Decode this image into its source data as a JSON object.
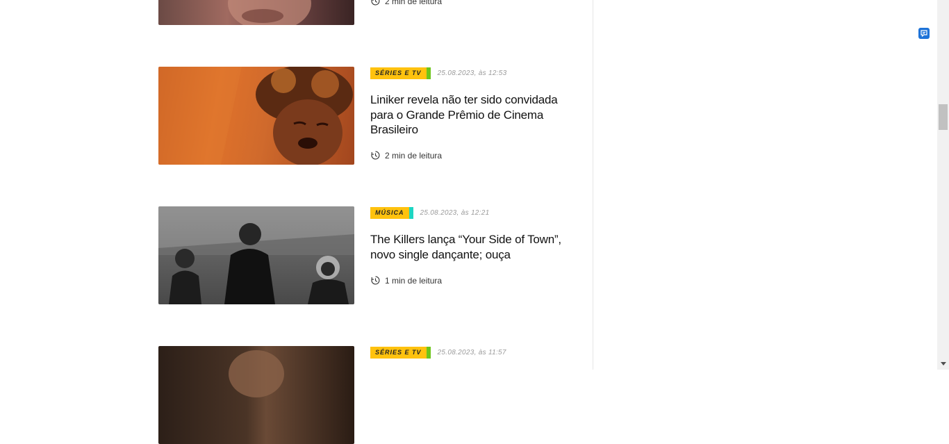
{
  "articles": [
    {
      "tag": "",
      "date": "",
      "title": "",
      "read_time": "2 min de leitura"
    },
    {
      "tag": "SÉRIES E TV",
      "tag_accent": "#6cc51b",
      "date": "25.08.2023, às 12:53",
      "title": "Liniker revela não ter sido convidada para o Grande Prêmio de Cinema Brasileiro",
      "read_time": "2 min de leitura"
    },
    {
      "tag": "MÚSICA",
      "tag_accent": "#1ed6c2",
      "date": "25.08.2023, às 12:21",
      "title": "The Killers lança “Your Side of Town”, novo single dançante; ouça",
      "read_time": "1 min de leitura"
    },
    {
      "tag": "SÉRIES E TV",
      "tag_accent": "#6cc51b",
      "date": "25.08.2023, às 11:57",
      "title": "",
      "read_time": ""
    }
  ],
  "colors": {
    "tag_bg": "#ffc20e",
    "floating_icon": "#1e73d8"
  },
  "icons": {
    "read_time": "clock-history-icon",
    "floating": "chat-bubble-icon",
    "scroll_down": "caret-down-icon"
  }
}
